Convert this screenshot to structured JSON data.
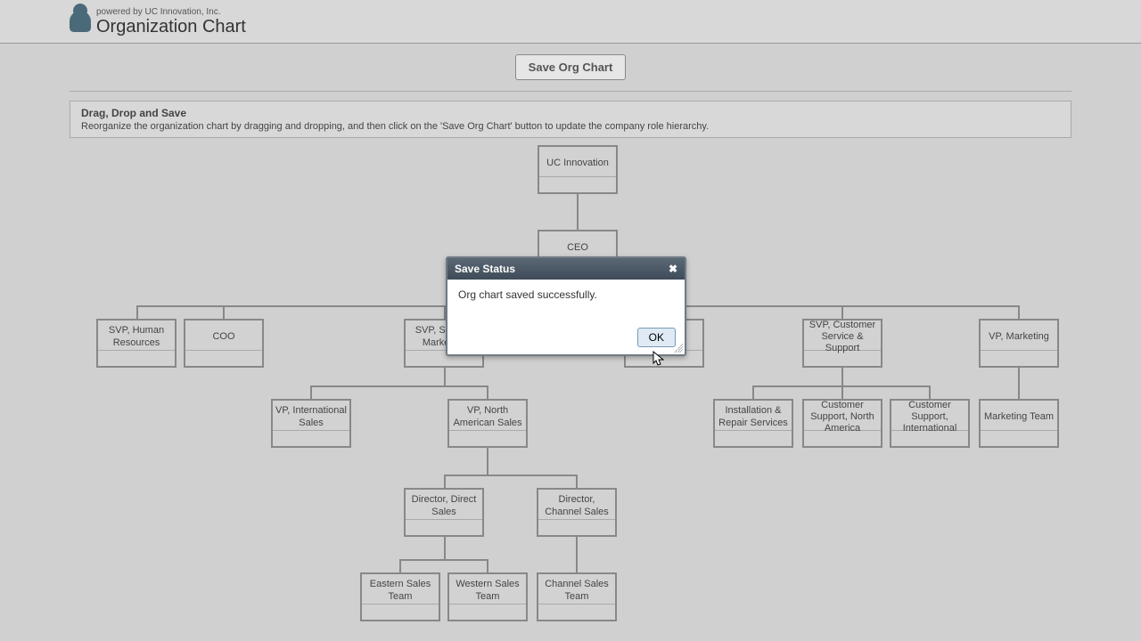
{
  "header": {
    "powered": "powered by UC Innovation, Inc.",
    "title": "Organization Chart"
  },
  "toolbar": {
    "save_label": "Save Org Chart"
  },
  "hint": {
    "title": "Drag, Drop and Save",
    "body": "Reorganize the organization chart by dragging and dropping, and then click on the 'Save Org Chart' button to update the company role hierarchy."
  },
  "nodes": {
    "root": "UC Innovation",
    "ceo": "CEO",
    "svp_hr": "SVP, Human Resources",
    "coo": "COO",
    "svp_sales_mkt": "SVP, Sales & Marketing",
    "unknown1": "",
    "svp_cust": "SVP, Customer Service & Support",
    "vp_mkt": "VP, Marketing",
    "vp_intl_sales": "VP, International Sales",
    "vp_na_sales": "VP, North American Sales",
    "install_repair": "Installation & Repair Services",
    "cust_na": "Customer Support, North America",
    "cust_intl": "Customer Support, International",
    "mkt_team": "Marketing Team",
    "dir_direct": "Director, Direct Sales",
    "dir_channel": "Director, Channel Sales",
    "eastern": "Eastern Sales Team",
    "western": "Western Sales Team",
    "channel_team": "Channel Sales Team"
  },
  "dialog": {
    "title": "Save Status",
    "message": "Org chart saved successfully.",
    "ok": "OK"
  }
}
